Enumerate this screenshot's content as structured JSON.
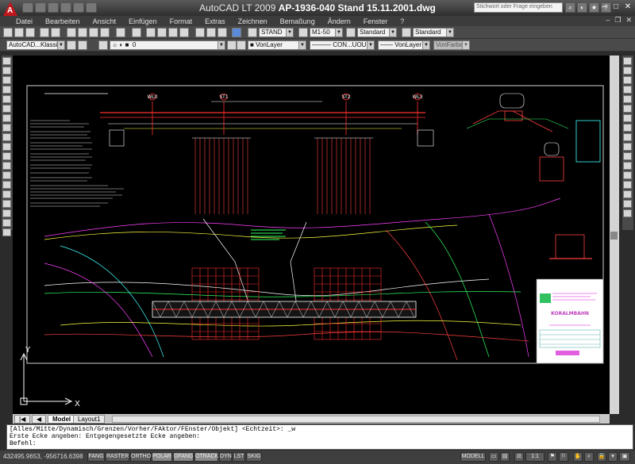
{
  "titlebar": {
    "app": "AutoCAD LT 2009",
    "file": "AP-1936-040 Stand 15.11.2001.dwg",
    "search_placeholder": "Stichwort oder Frage eingeben",
    "minimize": "–",
    "maximize": "□",
    "close": "✕"
  },
  "menu": [
    "Datei",
    "Bearbeiten",
    "Ansicht",
    "Einfügen",
    "Format",
    "Extras",
    "Zeichnen",
    "Bemaßung",
    "Ändern",
    "Fenster",
    "?"
  ],
  "toolbar": {
    "text_style": "STAND",
    "dim_style": "M1-50",
    "table_style": "Standard",
    "multileader_style": "Standard",
    "workspace": "AutoCAD...Klassisch",
    "layer": "0",
    "color": "VonLayer",
    "linetype": "CON...UOU",
    "lineweight": "VonLayer",
    "plotstyle": "VonFarbe"
  },
  "tabs": [
    "Model",
    "Layout1"
  ],
  "ucs": {
    "x": "X",
    "y": "Y"
  },
  "command": {
    "line1": "[Alles/Mitte/Dynamisch/Grenzen/Vorher/FAktor/FEnster/Objekt] <Echtzeit>: _w",
    "line2": "Erste Ecke angeben: Entgegengesetzte Ecke angeben:",
    "line3": "Befehl:"
  },
  "status": {
    "coords": "432495.9653, -956716.6398",
    "buttons": [
      "FANG",
      "RASTER",
      "ORTHO",
      "POLAR",
      "OFANG",
      "OTRACK",
      "DYN",
      "LST",
      "SKIG"
    ],
    "model": "MODELL",
    "scale": "1:1"
  },
  "drawing": {
    "axis_labels": [
      "WL0",
      "ST1",
      "ST2",
      "WL3"
    ],
    "title_block": "KORALMBAHN",
    "colors": {
      "background": "#000000",
      "red": "#ff2020",
      "green": "#30ff60",
      "yellow": "#ffff40",
      "white": "#ffffff",
      "cyan": "#40ffff",
      "magenta": "#ff40ff"
    }
  }
}
